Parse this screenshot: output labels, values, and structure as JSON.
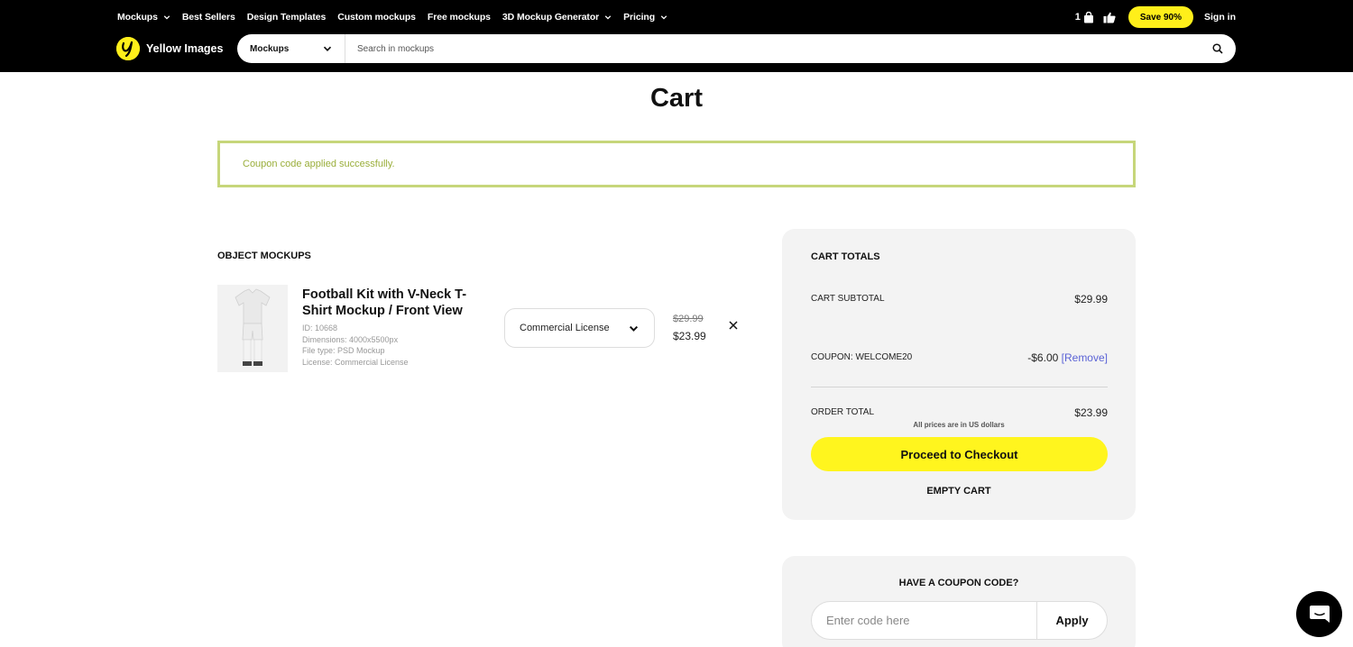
{
  "header": {
    "nav": [
      {
        "label": "Mockups",
        "dropdown": true
      },
      {
        "label": "Best Sellers",
        "dropdown": false
      },
      {
        "label": "Design Templates",
        "dropdown": false
      },
      {
        "label": "Custom mockups",
        "dropdown": false
      },
      {
        "label": "Free mockups",
        "dropdown": false
      },
      {
        "label": "3D Mockup Generator",
        "dropdown": true
      },
      {
        "label": "Pricing",
        "dropdown": true
      }
    ],
    "cart_count": "1",
    "save_label": "Save 90%",
    "signin_label": "Sign in",
    "brand": "Yellow Images",
    "search": {
      "category": "Mockups",
      "placeholder": "Search in mockups"
    }
  },
  "page": {
    "title": "Cart",
    "notice": "Coupon code applied successfully.",
    "section_label": "OBJECT MOCKUPS"
  },
  "item": {
    "title": "Football Kit with V-Neck T-Shirt Mockup / Front View",
    "id_line": "ID:  10668",
    "dimensions_line": "Dimensions:  4000x5500px",
    "filetype_line": "File type:  PSD Mockup",
    "license_line": "License:  Commercial License",
    "license_select": "Commercial License",
    "old_price": "$29.99",
    "new_price": "$23.99"
  },
  "totals": {
    "heading": "CART TOTALS",
    "subtotal_label": "CART SUBTOTAL",
    "subtotal_value": "$29.99",
    "coupon_label": "COUPON: WELCOME20",
    "coupon_value": "-$6.00",
    "coupon_remove": "[Remove]",
    "order_label": "ORDER TOTAL",
    "order_value": "$23.99",
    "usd_note": "All prices are in US dollars",
    "checkout_label": "Proceed to Checkout",
    "empty_label": "EMPTY CART"
  },
  "coupon": {
    "heading": "HAVE A COUPON CODE?",
    "placeholder": "Enter code here",
    "apply_label": "Apply"
  },
  "colors": {
    "accent_yellow": "#fff51e",
    "notice_border": "#c6d67a",
    "notice_text": "#9aae3a",
    "link_blue": "#5b63d6"
  }
}
